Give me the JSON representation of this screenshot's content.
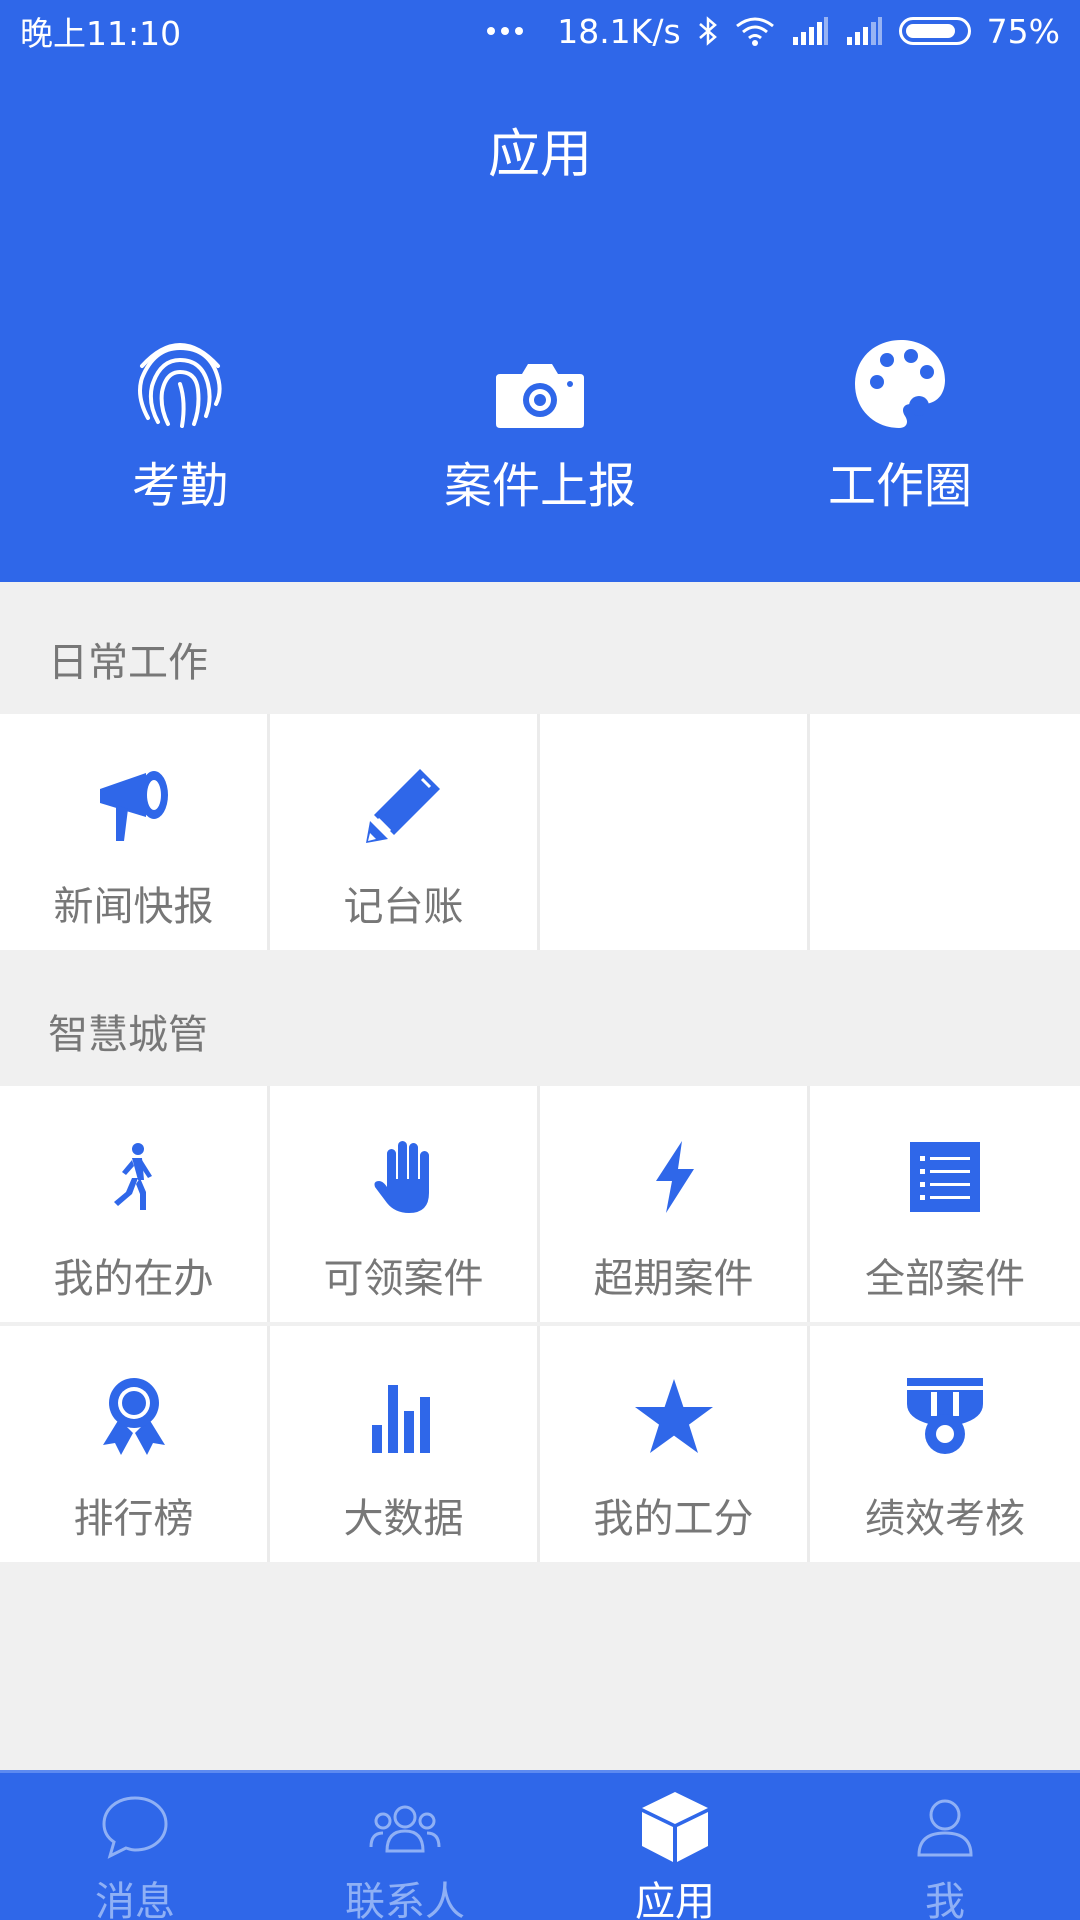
{
  "status_bar": {
    "time": "晚上11:10",
    "speed": "18.1K/s",
    "battery": "75%"
  },
  "header": {
    "title": "应用"
  },
  "quick_actions": [
    {
      "label": "考勤",
      "icon": "fingerprint-icon"
    },
    {
      "label": "案件上报",
      "icon": "camera-icon"
    },
    {
      "label": "工作圈",
      "icon": "palette-icon"
    }
  ],
  "sections": [
    {
      "title": "日常工作",
      "items": [
        {
          "label": "新闻快报",
          "icon": "megaphone-icon"
        },
        {
          "label": "记台账",
          "icon": "pencil-icon"
        }
      ]
    },
    {
      "title": "智慧城管",
      "items": [
        {
          "label": "我的在办",
          "icon": "walking-icon"
        },
        {
          "label": "可领案件",
          "icon": "hand-icon"
        },
        {
          "label": "超期案件",
          "icon": "lightning-icon"
        },
        {
          "label": "全部案件",
          "icon": "list-icon"
        },
        {
          "label": "排行榜",
          "icon": "award-icon"
        },
        {
          "label": "大数据",
          "icon": "bar-chart-icon"
        },
        {
          "label": "我的工分",
          "icon": "star-icon"
        },
        {
          "label": "绩效考核",
          "icon": "medal-icon"
        }
      ]
    }
  ],
  "tabs": [
    {
      "label": "消息",
      "icon": "chat-icon"
    },
    {
      "label": "联系人",
      "icon": "contacts-icon"
    },
    {
      "label": "应用",
      "icon": "cube-icon",
      "active": true
    },
    {
      "label": "我",
      "icon": "user-icon"
    }
  ],
  "colors": {
    "primary": "#2f67e9",
    "background": "#f0f0f0",
    "label": "#777777"
  }
}
